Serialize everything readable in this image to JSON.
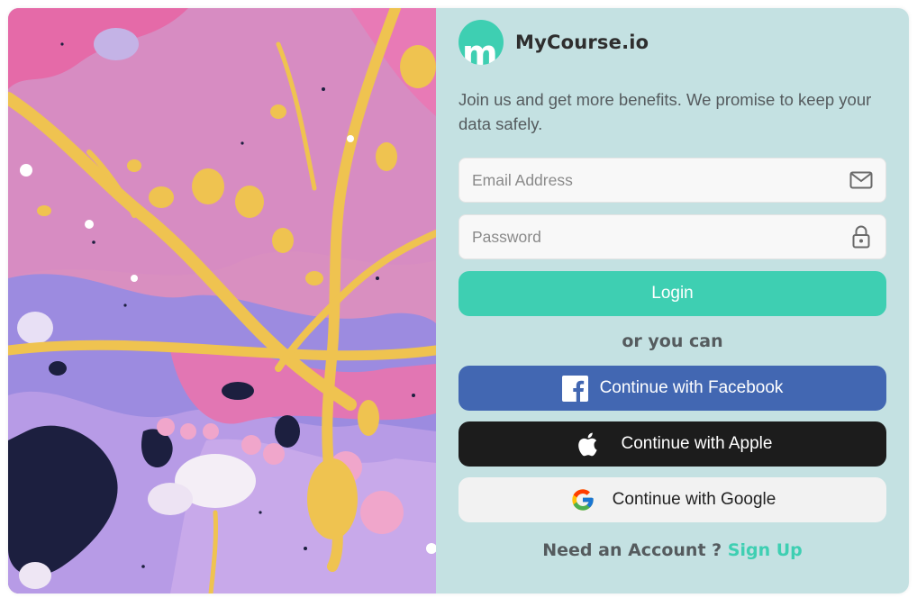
{
  "brand": {
    "name": "MyCourse.io",
    "logo_letter": "m",
    "accent_color": "#3ecfb2"
  },
  "tagline": "Join us and get more benefits. We promise to keep your data safely.",
  "form": {
    "email_placeholder": "Email Address",
    "email_value": "",
    "email_icon": "mail-icon",
    "password_placeholder": "Password",
    "password_value": "",
    "password_icon": "lock-icon",
    "login_label": "Login"
  },
  "divider_text": "or you can",
  "social": {
    "facebook": {
      "label": "Continue with Facebook",
      "icon": "facebook-icon",
      "color": "#4267b2"
    },
    "apple": {
      "label": "Continue with Apple",
      "icon": "apple-icon",
      "color": "#1c1c1c"
    },
    "google": {
      "label": "Continue with Google",
      "icon": "google-icon",
      "color": "#f2f2f2"
    }
  },
  "footer": {
    "prompt": "Need an Account ?",
    "link_label": "Sign Up"
  },
  "panel_color": "#c4e1e2",
  "artwork": {
    "description_icon": "abstract-paint-image"
  }
}
